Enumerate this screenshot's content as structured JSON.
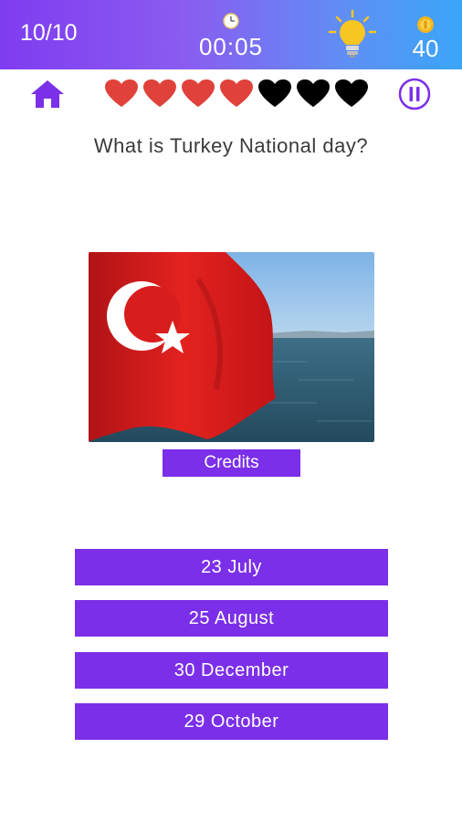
{
  "header": {
    "progress": "10/10",
    "timer": "00:05",
    "coins": "40",
    "icons": [
      "clock-icon",
      "lightbulb-icon",
      "coin-icon"
    ]
  },
  "controls": {
    "home_icon": "home-icon",
    "pause_icon": "pause-icon"
  },
  "lives": {
    "total": 7,
    "remaining": 4,
    "colors": {
      "remaining": "#e0413b",
      "lost": "#000000"
    }
  },
  "question": {
    "text": "What is Turkey National day?"
  },
  "image": {
    "credits_label": "Credits"
  },
  "answers": [
    {
      "label": "23 July"
    },
    {
      "label": "25 August"
    },
    {
      "label": "30 December"
    },
    {
      "label": "29 October"
    }
  ],
  "colors": {
    "accent": "#7b2fe8",
    "header_gradient": [
      "#7f3cf0",
      "#3aa6f8"
    ]
  }
}
